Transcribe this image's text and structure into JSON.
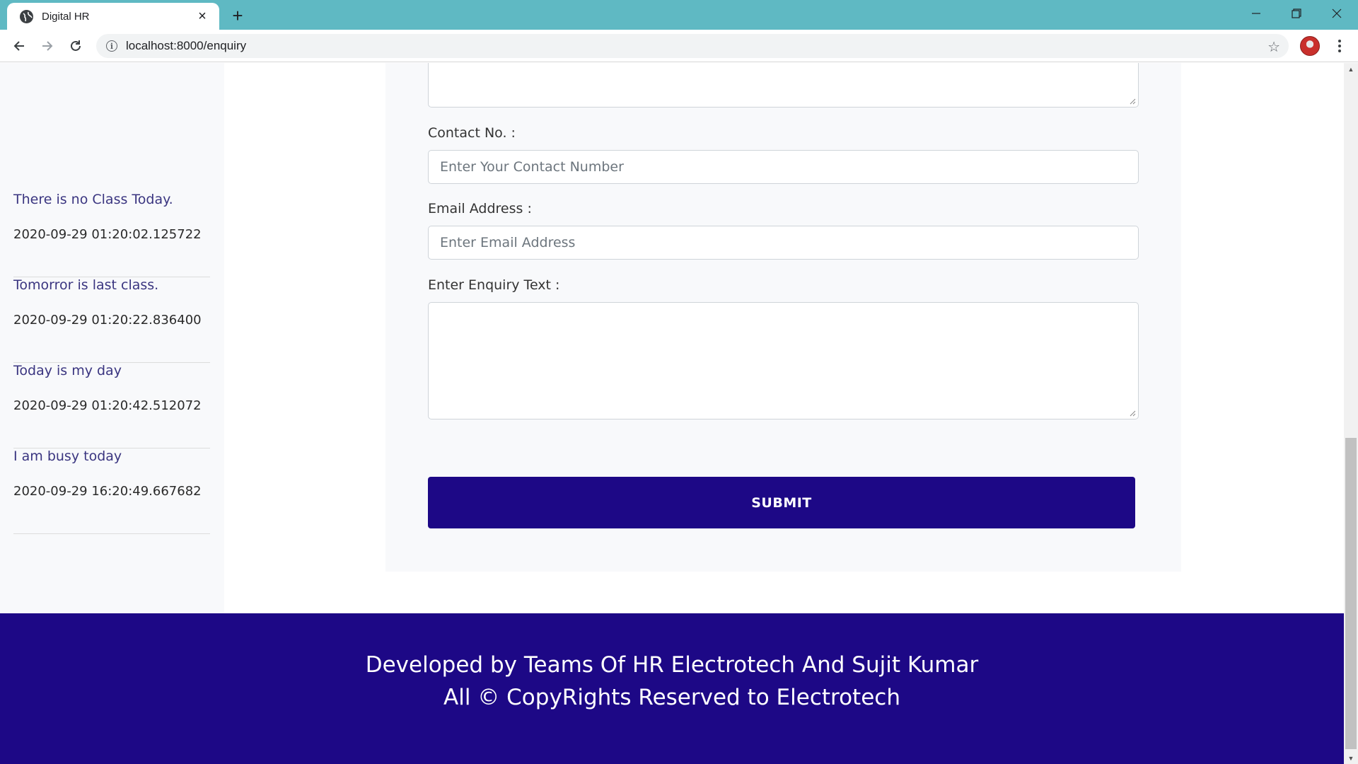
{
  "browser": {
    "tab_title": "Digital HR",
    "new_tab_symbol": "+",
    "close_symbol": "×",
    "url": "localhost:8000/enquiry"
  },
  "sidebar": {
    "notices": [
      {
        "title": "There is no Class Today.",
        "date": "2020-09-29 01:20:02.125722"
      },
      {
        "title": "Tomorror is last class.",
        "date": "2020-09-29 01:20:22.836400"
      },
      {
        "title": "Today is my day",
        "date": "2020-09-29 01:20:42.512072"
      },
      {
        "title": "I am busy today",
        "date": "2020-09-29 16:20:49.667682"
      }
    ]
  },
  "form": {
    "contact_label": "Contact No. :",
    "contact_placeholder": "Enter Your Contact Number",
    "email_label": "Email Address :",
    "email_placeholder": "Enter Email Address",
    "enquiry_label": "Enter Enquiry Text :",
    "submit_label": "SUBMIT"
  },
  "footer": {
    "line1": "Developed by Teams Of HR Electrotech And Sujit Kumar",
    "line2": "All © CopyRights Reserved to Electrotech"
  },
  "colors": {
    "titlebar": "#5fb9c3",
    "brand_primary": "#1d0886",
    "notice_title": "#3a3580",
    "panel_bg": "#f8f9fb"
  },
  "icons": [
    "globe-icon",
    "close-icon",
    "plus-icon",
    "minimize-icon",
    "restore-icon",
    "back-icon",
    "forward-icon",
    "reload-icon",
    "info-icon",
    "star-icon",
    "menu-icon"
  ]
}
